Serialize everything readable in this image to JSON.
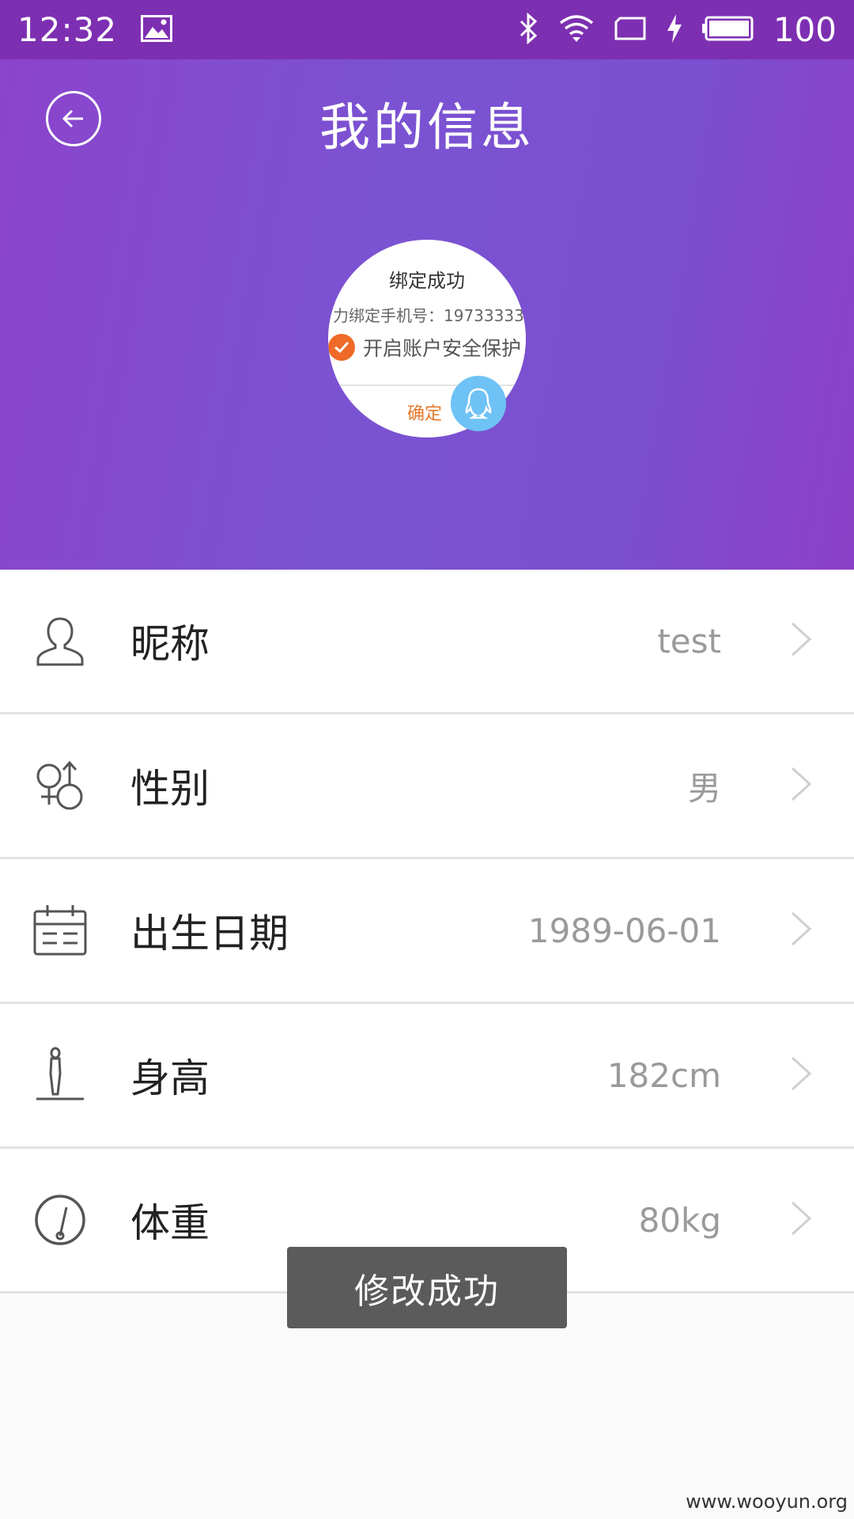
{
  "status_bar": {
    "time": "12:32",
    "battery": "100",
    "icons": [
      "image-icon",
      "bluetooth-icon",
      "wifi-icon",
      "screen-rotate-icon",
      "charging-icon",
      "battery-icon"
    ]
  },
  "header": {
    "title": "我的信息",
    "back_icon": "back-arrow-icon"
  },
  "avatar": {
    "title": "绑定成功",
    "phone_line": "力绑定手机号：19733333",
    "checkbox_label": "开启账户安全保护",
    "confirm": "确定",
    "badge_icon": "qq-icon"
  },
  "profile": {
    "rows": [
      {
        "label": "昵称",
        "value": "test",
        "icon": "user-icon"
      },
      {
        "label": "性别",
        "value": "男",
        "icon": "gender-icon"
      },
      {
        "label": "出生日期",
        "value": "1989-06-01",
        "icon": "calendar-icon"
      },
      {
        "label": "身高",
        "value": "182cm",
        "icon": "height-icon"
      },
      {
        "label": "体重",
        "value": "80kg",
        "icon": "scale-icon"
      }
    ]
  },
  "toast": "修改成功",
  "watermark": "www.wooyun.org",
  "colors": {
    "status_bar": "#7d2fb2",
    "header_gradient_start": "#8b44cc",
    "header_gradient_end": "#8c3fc8",
    "toast_bg": "#5b5b5b",
    "value_text": "#9a9a9a"
  }
}
